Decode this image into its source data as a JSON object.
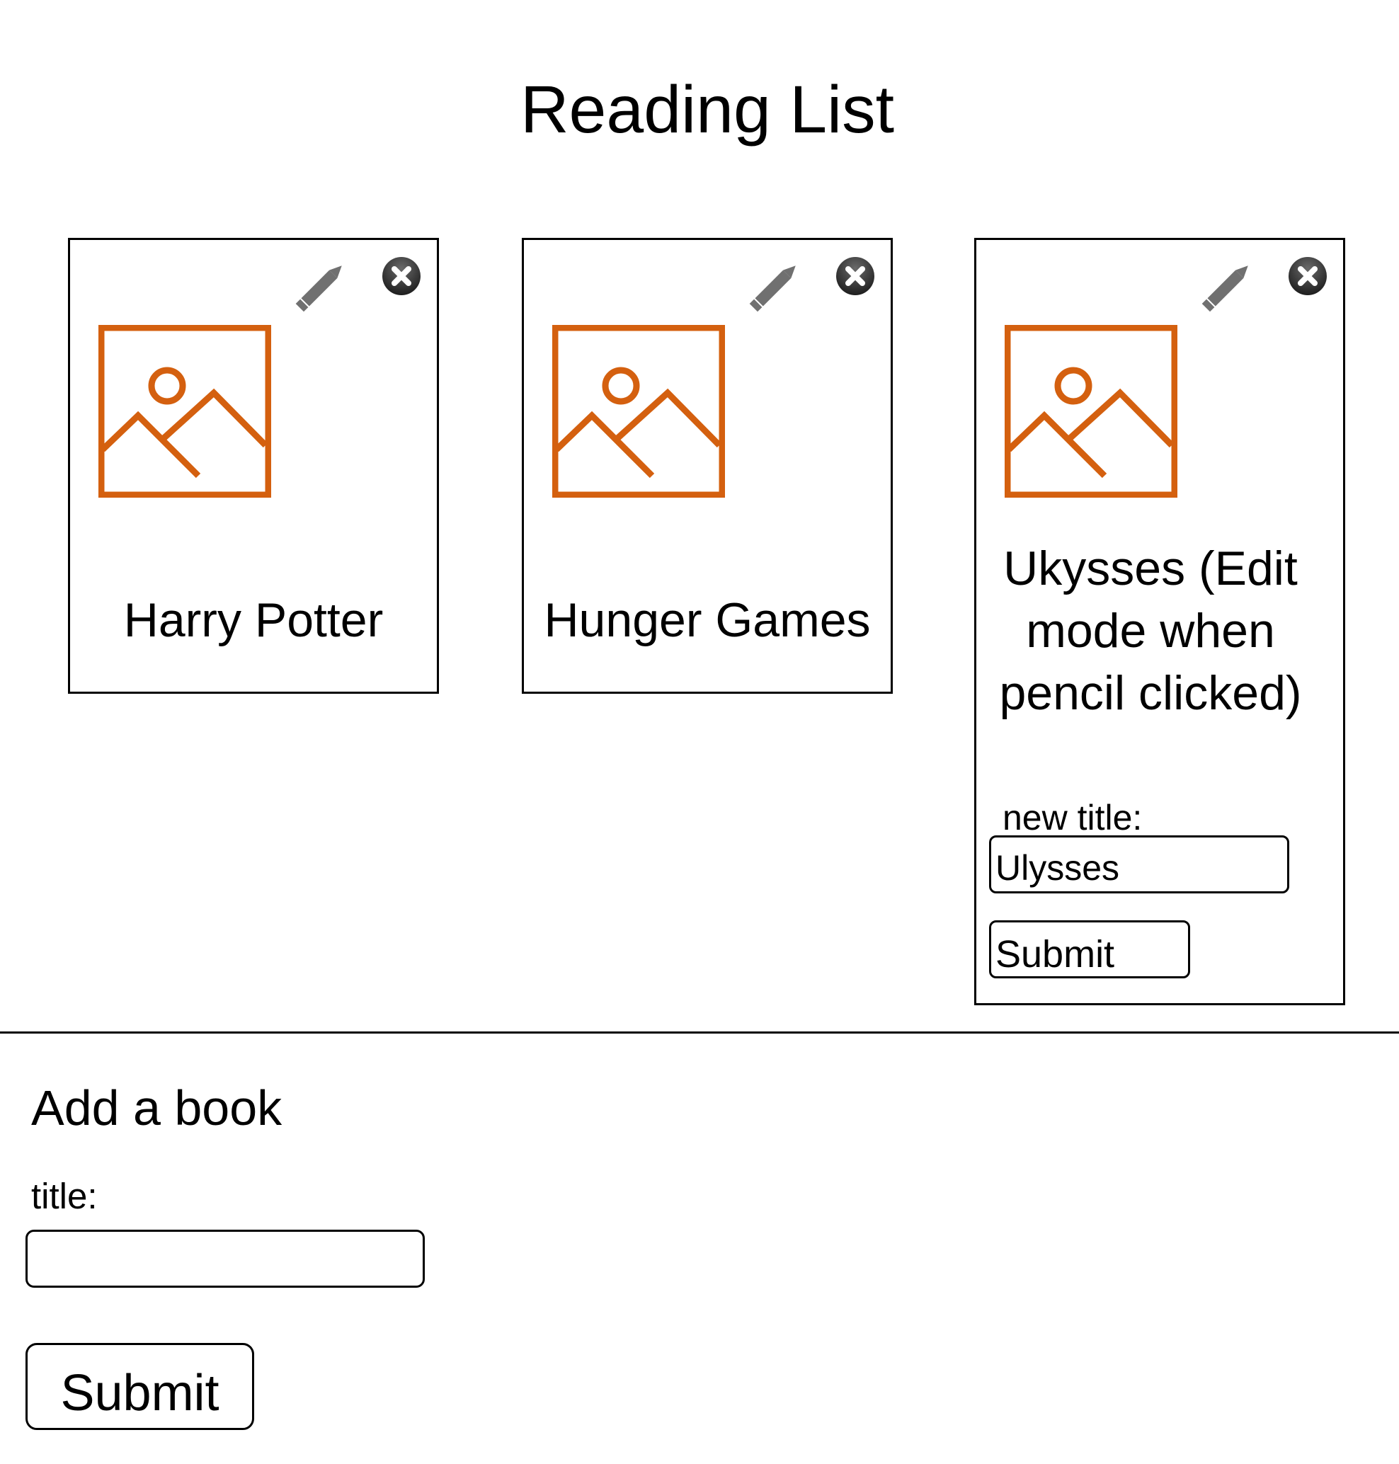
{
  "page": {
    "title": "Reading List"
  },
  "books": [
    {
      "title": "Harry Potter",
      "edit_icon": "pencil-icon",
      "delete_icon": "close-circle-icon",
      "cover_icon": "image-placeholder-icon"
    },
    {
      "title": "Hunger Games",
      "edit_icon": "pencil-icon",
      "delete_icon": "close-circle-icon",
      "cover_icon": "image-placeholder-icon"
    },
    {
      "title": "Ukysses (Edit mode when pencil clicked)",
      "edit_icon": "pencil-icon",
      "delete_icon": "close-circle-icon",
      "cover_icon": "image-placeholder-icon",
      "edit_form": {
        "label": "new title:",
        "input_value": "Ulysses",
        "submit_label": "Submit"
      }
    }
  ],
  "add_form": {
    "heading": "Add a book",
    "title_label": "title:",
    "title_value": "",
    "submit_label": "Submit"
  },
  "colors": {
    "cover_icon": "#d4600f",
    "pencil_icon": "#707070",
    "close_icon_bg": "#303030",
    "border": "#000000"
  }
}
